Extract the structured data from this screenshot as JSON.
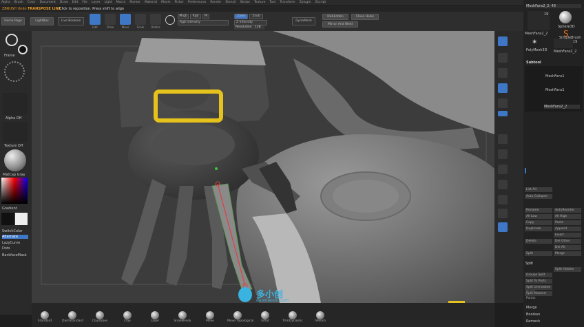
{
  "menu": [
    "Alpha",
    "Brush",
    "Color",
    "Document",
    "Draw",
    "Edit",
    "File",
    "Layer",
    "Light",
    "Macro",
    "Marker",
    "Material",
    "Movie",
    "Picker",
    "Preferences",
    "Render",
    "Stencil",
    "Stroke",
    "Texture",
    "Tool",
    "Transform",
    "Zplugin",
    "Zscript"
  ],
  "status": {
    "left": "ZBRUSH Undo",
    "highlight": "TRANSPOSE LINE",
    "hint": "Click to reposition. Press shift to align"
  },
  "toolbar": {
    "home_page": "Home Page",
    "lightbox": "LightBox",
    "live_boolean": "Live Boolean",
    "edit": "Edit",
    "draw": "Draw",
    "move": "Move",
    "scale": "Scale",
    "rotate": "Rotate",
    "mrgb": "Mrgb",
    "rgb": "Rgb",
    "m": "M",
    "zadd": "Zadd",
    "zsub": "Zsub",
    "rgb_intensity": "Rgb Intensity",
    "z_intensity": "Z Intensity",
    "resolution_label": "Resolution",
    "resolution_value": "128",
    "dynamesh": "DynaMesh",
    "del_hidden": "DelHidden",
    "close_holes": "Close Holes",
    "mirror_and_weld": "Mirror And Weld"
  },
  "left_panel": {
    "frame_label": "Frame",
    "alpha_off": "Alpha Off",
    "texture_off": "Texture Off",
    "matcap": "MatCap Gray",
    "gradient": "Gradient",
    "switch_color": "SwitchColor",
    "alternate": "Alternate",
    "lazy_curve": "LazyCurve",
    "dots": "Dots",
    "backface_mask": "BackfaceMask"
  },
  "right_panel": {
    "top_tool": "MeshFans2_2: 48",
    "tools": [
      {
        "label": "MeshFans2_2",
        "count": "19"
      },
      {
        "label": "Sphere3D"
      },
      {
        "label": "PolyMesh3D"
      },
      {
        "label": "MeshFans2_2",
        "count": "19"
      },
      {
        "label": "SimpleBrush"
      }
    ],
    "subtool": "Subtool",
    "subtools": [
      "MeshFans1",
      "MeshFans1",
      "MeshFans2_2"
    ],
    "list_all": "List All",
    "auto_collapse": "Auto Collapse",
    "rows": [
      [
        "Rename",
        "AutoReorder"
      ],
      [
        "All Low",
        "All High"
      ],
      [
        "Copy",
        "Paste"
      ],
      [
        "Duplicate",
        "Append"
      ],
      [
        "",
        "Insert"
      ],
      [
        "Delete",
        "Del Other"
      ],
      [
        "",
        "Del All"
      ],
      [
        "Split",
        "Merge"
      ]
    ],
    "geometry_bottom": [
      "Merge",
      "Boolean",
      "Remesh"
    ],
    "split_label": "Split",
    "split_rows": [
      "Split Hidden",
      "Groups Split",
      "Split To Parts",
      "Split Unmasked Points",
      "Split Masked Points"
    ]
  },
  "brushes": [
    "Standard",
    "DamStandard",
    "ClayTubes",
    "Clay",
    "Layer",
    "SnakeHook",
    "Move",
    "Move Topological",
    "Inflat",
    "TrimDynamic",
    "hPolish"
  ],
  "watermark": {
    "cn": "多小创",
    "url": "duoxiaoshi.com"
  },
  "colors": {
    "accent": "#3f77c7",
    "highlight": "#e89a24",
    "clip": "#e6c21c"
  }
}
